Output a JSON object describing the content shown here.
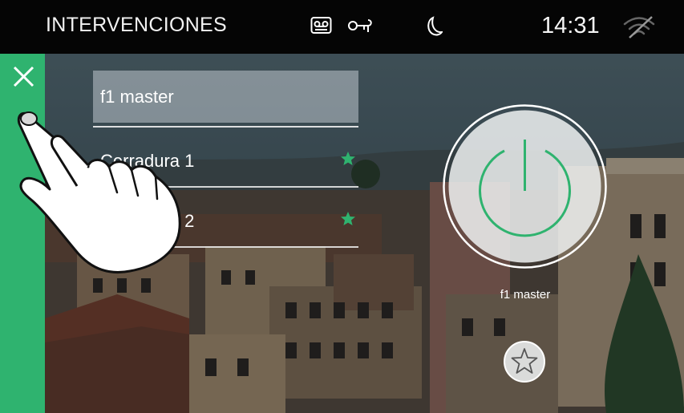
{
  "status_bar": {
    "title": "INTERVENCIONES",
    "time": "14:31",
    "icons": [
      "answering-machine-icon",
      "key-icon",
      "moon-icon",
      "wifi-off-icon"
    ]
  },
  "sidebar": {
    "close_icon": "close-icon",
    "accent_color": "#2fb36f"
  },
  "list": {
    "header": "f1 master",
    "items": [
      {
        "label": "Cerradura 1",
        "favorite": true
      },
      {
        "label": "Cerradura 2",
        "favorite": true
      }
    ]
  },
  "main_action": {
    "caption": "f1 master",
    "icon": "power-icon",
    "favorite_icon": "star-outline-icon"
  }
}
